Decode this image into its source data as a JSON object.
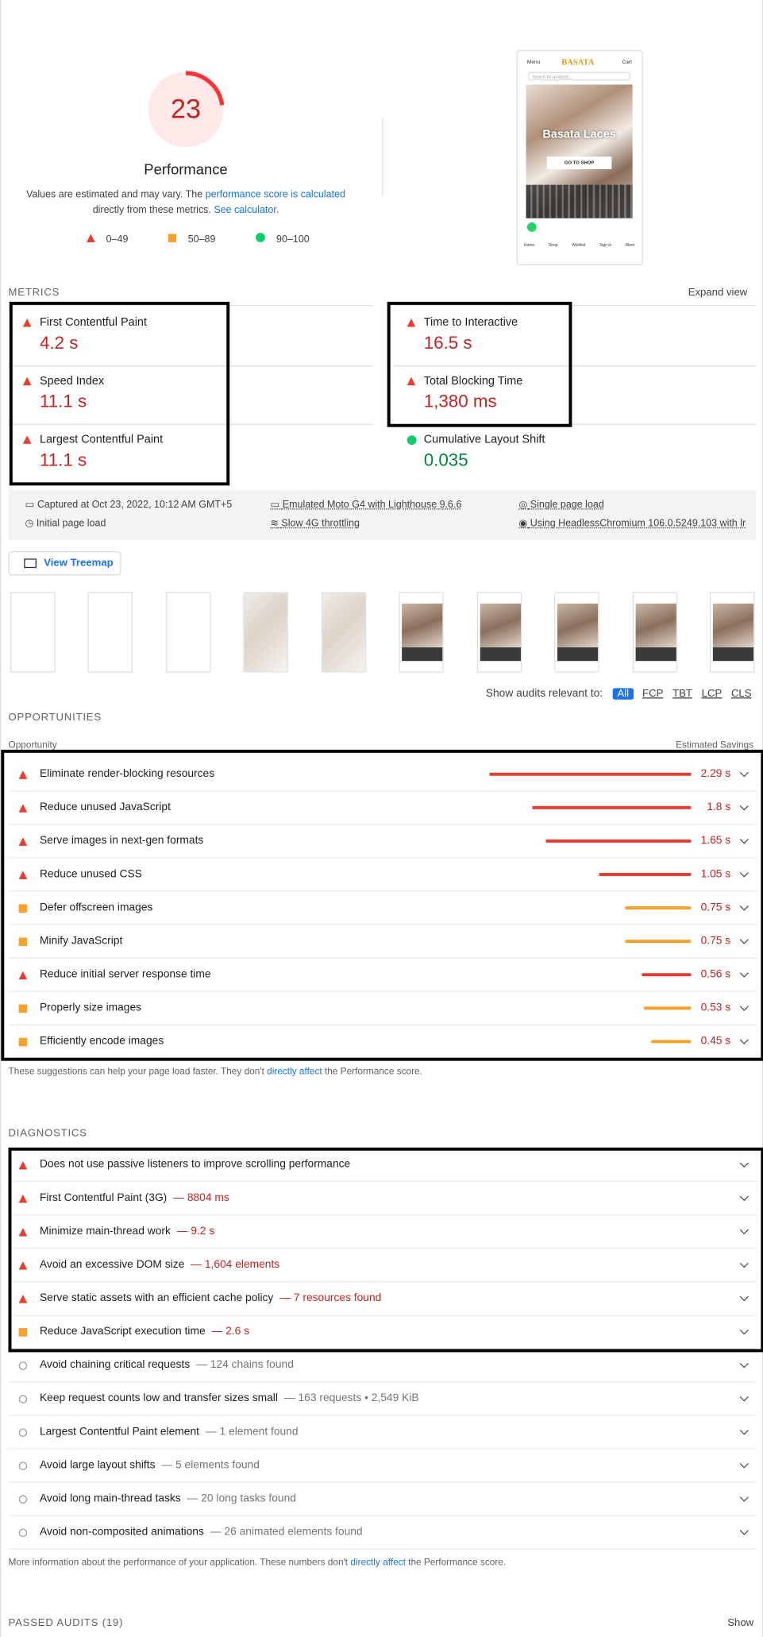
{
  "gauge": {
    "score": "23",
    "label": "Performance",
    "fraction": 0.23,
    "color": "#ff3333"
  },
  "note": {
    "prefix": "Values are estimated and may vary. The ",
    "link1": "performance score is calculated",
    "middle": "directly from these metrics. ",
    "link2": "See calculator."
  },
  "legend": [
    "0–49",
    "50–89",
    "90–100"
  ],
  "preview": {
    "menu": "Menu",
    "brand": "BASATA",
    "cart": "Cart",
    "search_placeholder": "Search for products...",
    "hero_title": "Basata Laces",
    "cta": "GO TO SHOP",
    "nav": [
      "Home",
      "Shop",
      "Wishlist",
      "Sign in",
      "More"
    ]
  },
  "metrics": {
    "title": "METRICS",
    "expand": "Expand view",
    "items": [
      {
        "name": "First Contentful Paint",
        "value": "4.2 s",
        "status": "fail"
      },
      {
        "name": "Time to Interactive",
        "value": "16.5 s",
        "status": "fail"
      },
      {
        "name": "Speed Index",
        "value": "11.1 s",
        "status": "fail"
      },
      {
        "name": "Total Blocking Time",
        "value": "1,380 ms",
        "status": "fail"
      },
      {
        "name": "Largest Contentful Paint",
        "value": "11.1 s",
        "status": "fail"
      },
      {
        "name": "Cumulative Layout Shift",
        "value": "0.035",
        "status": "pass"
      }
    ]
  },
  "env": {
    "captured": "Captured at Oct 23, 2022, 10:12 AM GMT+5",
    "load": "Initial page load",
    "device": "Emulated Moto G4 with Lighthouse 9.6.6",
    "throttle": "Slow 4G throttling",
    "session": "Single page load",
    "browser": "Using HeadlessChromium 106.0.5249.103 with lr"
  },
  "treemap": "View Treemap",
  "filter": {
    "label": "Show audits relevant to:",
    "options": [
      "All",
      "FCP",
      "TBT",
      "LCP",
      "CLS"
    ]
  },
  "opportunities": {
    "title": "OPPORTUNITIES",
    "col1": "Opportunity",
    "col2": "Estimated Savings",
    "rows": [
      {
        "title": "Eliminate render-blocking resources",
        "savings": "2.29 s",
        "seconds": 2.29,
        "status": "fail"
      },
      {
        "title": "Reduce unused JavaScript",
        "savings": "1.8 s",
        "seconds": 1.8,
        "status": "fail"
      },
      {
        "title": "Serve images in next-gen formats",
        "savings": "1.65 s",
        "seconds": 1.65,
        "status": "fail"
      },
      {
        "title": "Reduce unused CSS",
        "savings": "1.05 s",
        "seconds": 1.05,
        "status": "fail"
      },
      {
        "title": "Defer offscreen images",
        "savings": "0.75 s",
        "seconds": 0.75,
        "status": "average"
      },
      {
        "title": "Minify JavaScript",
        "savings": "0.75 s",
        "seconds": 0.75,
        "status": "average"
      },
      {
        "title": "Reduce initial server response time",
        "savings": "0.56 s",
        "seconds": 0.56,
        "status": "fail"
      },
      {
        "title": "Properly size images",
        "savings": "0.53 s",
        "seconds": 0.53,
        "status": "average"
      },
      {
        "title": "Efficiently encode images",
        "savings": "0.45 s",
        "seconds": 0.45,
        "status": "average"
      }
    ],
    "footer_prefix": "These suggestions can help your page load faster. They don't ",
    "footer_link": "directly affect",
    "footer_suffix": " the Performance score."
  },
  "diagnostics": {
    "title": "DIAGNOSTICS",
    "rows": [
      {
        "title": "Does not use passive listeners to improve scrolling performance",
        "detail": "",
        "status": "fail"
      },
      {
        "title": "First Contentful Paint (3G)",
        "detail": "— 8804 ms",
        "status": "fail"
      },
      {
        "title": "Minimize main-thread work",
        "detail": "— 9.2 s",
        "status": "fail"
      },
      {
        "title": "Avoid an excessive DOM size",
        "detail": "— 1,604 elements",
        "status": "fail"
      },
      {
        "title": "Serve static assets with an efficient cache policy",
        "detail": "— 7 resources found",
        "status": "fail"
      },
      {
        "title": "Reduce JavaScript execution time",
        "detail": "— 2.6 s",
        "status": "average"
      },
      {
        "title": "Avoid chaining critical requests",
        "detail": "— 124 chains found",
        "status": "info"
      },
      {
        "title": "Keep request counts low and transfer sizes small",
        "detail": "— 163 requests • 2,549 KiB",
        "status": "info"
      },
      {
        "title": "Largest Contentful Paint element",
        "detail": "— 1 element found",
        "status": "info"
      },
      {
        "title": "Avoid large layout shifts",
        "detail": "— 5 elements found",
        "status": "info"
      },
      {
        "title": "Avoid long main-thread tasks",
        "detail": "— 20 long tasks found",
        "status": "info"
      },
      {
        "title": "Avoid non-composited animations",
        "detail": "— 26 animated elements found",
        "status": "info"
      }
    ],
    "footer_prefix": "More information about the performance of your application. These numbers don't ",
    "footer_link": "directly affect",
    "footer_suffix": " the Performance score."
  },
  "passed": {
    "label": "PASSED AUDITS",
    "count": "(19)",
    "show": "Show"
  }
}
